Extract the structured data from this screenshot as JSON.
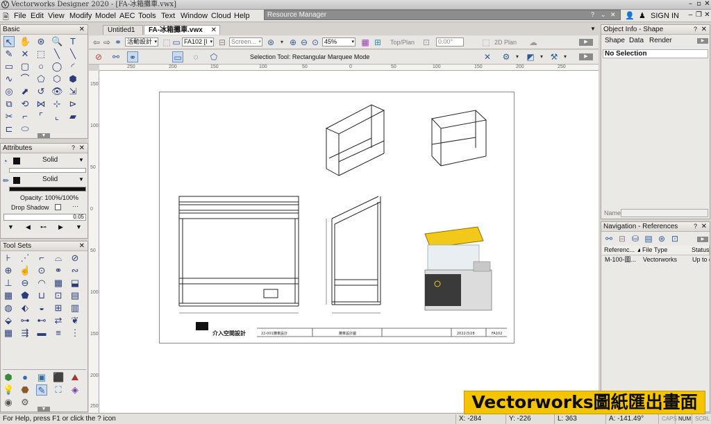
{
  "app": {
    "title": "Vectorworks Designer 2020 - [FA-冰箱攤車.vwx]",
    "menu": [
      "File",
      "Edit",
      "View",
      "Modify",
      "Model",
      "AEC",
      "Tools",
      "Text",
      "Window",
      "Cloud",
      "Help"
    ],
    "resource_manager": "Resource Manager",
    "sign_in": "SIGN IN"
  },
  "tabs": [
    "Untitled1",
    "FA-冰箱攤車.vwx"
  ],
  "panels": {
    "basic": "Basic",
    "attributes": {
      "title": "Attributes",
      "fill": "Solid",
      "pen": "Solid",
      "opacity": "Opacity: 100%/100%",
      "drop_shadow": "Drop Shadow",
      "line_value": "0.05"
    },
    "tool_sets": "Tool Sets",
    "object_info": {
      "title": "Object Info - Shape",
      "tabs": [
        "Shape",
        "Data",
        "Render"
      ],
      "selection": "No Selection",
      "name_label": "Name"
    },
    "navigation": {
      "title": "Navigation - References",
      "columns": [
        "Referenc...",
        "File Type",
        "Status"
      ],
      "rows": [
        [
          "M-100-圖...",
          "Vectorworks",
          "Up to d"
        ]
      ]
    }
  },
  "view_bar": {
    "class": "活動設計",
    "layer": "FA102 [I",
    "render": "Screen...",
    "zoom": "45%",
    "view": "Top/Plan",
    "angle": "0.00°",
    "projection": "2D Plan"
  },
  "mode_bar": {
    "text": "Selection Tool: Rectangular Marquee Mode"
  },
  "rulers": {
    "top": [
      "250",
      "200",
      "150",
      "100",
      "50",
      "0",
      "50",
      "100",
      "150",
      "200",
      "250"
    ],
    "left": [
      "150",
      "100",
      "50",
      "0",
      "50",
      "100",
      "150",
      "200",
      "250"
    ]
  },
  "drawing": {
    "title_block": [
      "22-001",
      "攤車設計",
      "攤車設計圖",
      "2022/3/28",
      "FA102"
    ],
    "firm": "介入空間設計"
  },
  "status": {
    "help": "For Help, press F1 or click the ? icon",
    "x": "X: -284",
    "y": "Y: -226",
    "l": "L: 363",
    "a": "A: -141.49°",
    "caps": "CAPS",
    "num": "NUM",
    "scrl": "SCRL"
  },
  "banner": "Vectorworks圖紙匯出畫面"
}
